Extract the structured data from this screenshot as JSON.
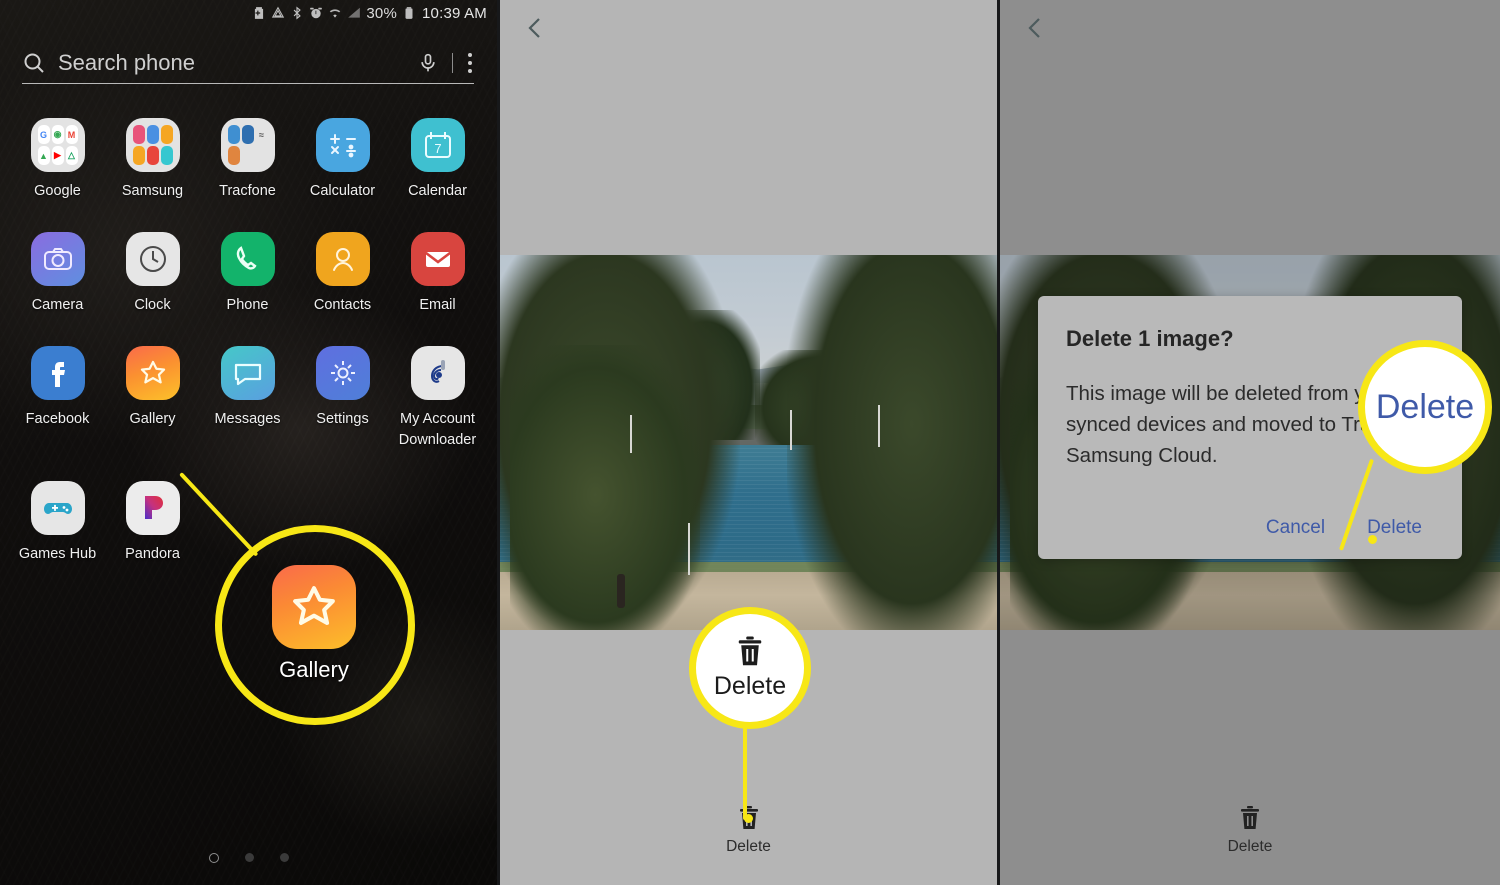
{
  "panels": [
    {
      "name": "home-screen"
    },
    {
      "name": "gallery-photo-view"
    },
    {
      "name": "gallery-delete-dialog"
    }
  ],
  "status_bar": {
    "battery_percent": "30%",
    "time": "10:39 AM",
    "icons": [
      "battery-saver-icon",
      "data-saver-icon",
      "bluetooth-icon",
      "alarm-icon",
      "wifi-icon",
      "signal-icon",
      "battery-icon"
    ]
  },
  "search": {
    "placeholder": "Search phone",
    "icons": [
      "search-icon",
      "microphone-icon",
      "more-options-icon"
    ]
  },
  "app_grid": {
    "rows": [
      [
        {
          "label": "Google",
          "type": "folder",
          "colors": [
            "#4285F4",
            "#34A853",
            "#EA4335",
            "#34A853",
            "#FF0000",
            "#1DA462"
          ]
        },
        {
          "label": "Samsung",
          "type": "folder",
          "colors": [
            "#e8537a",
            "#4a90e2",
            "#f5a623",
            "#f5a623",
            "#e8453c",
            "#36c7d0"
          ]
        },
        {
          "label": "Tracfone",
          "type": "folder",
          "colors": [
            "#3f8fd1",
            "#2f6fb0",
            "#ffffff",
            "#e0853f",
            "#00000000",
            "#00000000"
          ]
        },
        {
          "label": "Calculator",
          "type": "icon",
          "icon": "calculator-icon",
          "bg": "#49a6e0"
        },
        {
          "label": "Calendar",
          "type": "icon",
          "icon": "calendar-icon",
          "bg": "#3fc0d0"
        }
      ],
      [
        {
          "label": "Camera",
          "type": "icon",
          "icon": "camera-icon",
          "bg": "#7b7fe0"
        },
        {
          "label": "Clock",
          "type": "icon",
          "icon": "clock-icon",
          "bg": "#e6e6e6"
        },
        {
          "label": "Phone",
          "type": "icon",
          "icon": "phone-icon",
          "bg": "#13b36b"
        },
        {
          "label": "Contacts",
          "type": "icon",
          "icon": "contacts-icon",
          "bg": "#f0a51e"
        },
        {
          "label": "Email",
          "type": "icon",
          "icon": "email-icon",
          "bg": "#d8453f"
        }
      ],
      [
        {
          "label": "Facebook",
          "type": "icon",
          "icon": "facebook-icon",
          "bg": "#3b7ed0"
        },
        {
          "label": "Gallery",
          "type": "icon",
          "icon": "gallery-icon",
          "bg": "#f8932c"
        },
        {
          "label": "Messages",
          "type": "icon",
          "icon": "messages-icon",
          "bg": "#3fb6c4"
        },
        {
          "label": "Settings",
          "type": "icon",
          "icon": "settings-icon",
          "bg": "#5566d8"
        },
        {
          "label": "My Account Downloader",
          "type": "icon",
          "icon": "my-account-downloader-icon",
          "bg": "#e0e0e0"
        }
      ],
      [
        {
          "label": "Games Hub",
          "type": "icon",
          "icon": "games-hub-icon",
          "bg": "#e6e6e6"
        },
        {
          "label": "Pandora",
          "type": "icon",
          "icon": "pandora-icon",
          "bg": "#ececec"
        },
        {
          "label": "",
          "type": "empty",
          "icon": "",
          "bg": ""
        },
        {
          "label": "",
          "type": "empty",
          "icon": "",
          "bg": ""
        },
        {
          "label": "",
          "type": "empty",
          "icon": "",
          "bg": ""
        }
      ]
    ],
    "page_dots": {
      "count": 3,
      "active_index": 0
    }
  },
  "viewer": {
    "back_icon": "back-chevron-icon",
    "toolbar": {
      "delete_label": "Delete",
      "delete_icon": "trash-icon"
    }
  },
  "dialog": {
    "title": "Delete 1 image?",
    "body": "This image will be deleted from your synced devices and moved to Trash in Samsung Cloud.",
    "cancel_label": "Cancel",
    "delete_label": "Delete"
  },
  "callouts": {
    "gallery": {
      "label": "Gallery",
      "icon": "gallery-icon"
    },
    "delete_tool": {
      "label": "Delete",
      "icon": "trash-icon"
    },
    "delete_dialog": {
      "label": "Delete"
    }
  },
  "colors": {
    "highlight": "#f7e716",
    "link_blue": "#3f5aa8",
    "panel_bg": "#b5b5b5",
    "panel_bg_dim": "#8e8e8e"
  }
}
